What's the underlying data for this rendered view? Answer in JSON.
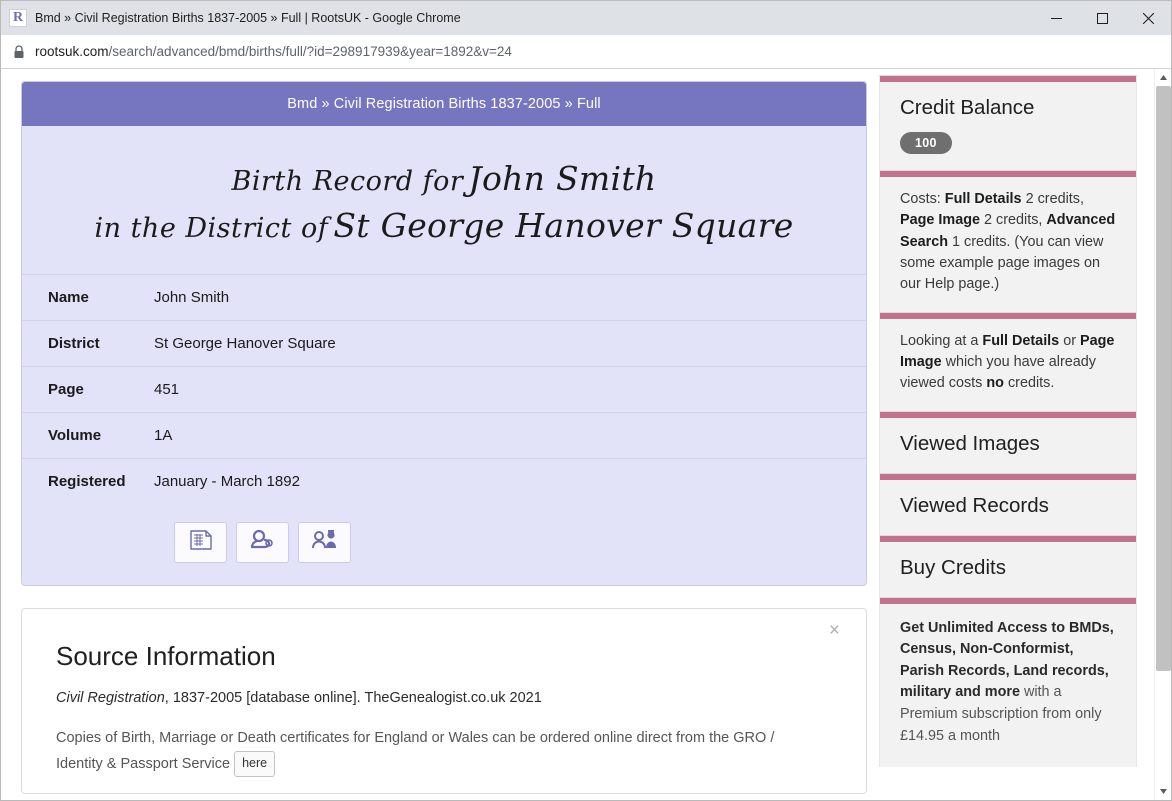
{
  "browser": {
    "window_title": "Bmd » Civil Registration Births 1837-2005 » Full | RootsUK - Google Chrome",
    "favicon_letter": "R",
    "url_domain": "rootsuk.com",
    "url_path": "/search/advanced/bmd/births/full/?id=298917939&year=1892&v=24",
    "minimize_label": "minimize-icon",
    "maximize_label": "maximize-icon",
    "close_label": "close-icon",
    "lock_label": "lock-icon"
  },
  "record": {
    "breadcrumb": "Bmd » Civil Registration Births 1837-2005 » Full",
    "title_line1": "Birth Record for",
    "title_name": "John Smith",
    "title_line2": "in the District of",
    "title_district": "St George Hanover Square",
    "fields": [
      {
        "key": "Name",
        "value": "John Smith"
      },
      {
        "key": "District",
        "value": "St George Hanover Square"
      },
      {
        "key": "Page",
        "value": "451"
      },
      {
        "key": "Volume",
        "value": "1A"
      },
      {
        "key": "Registered",
        "value": "January - March 1892"
      }
    ],
    "actions": [
      {
        "name": "page-image-icon",
        "title": "Page Image"
      },
      {
        "name": "baby-icon",
        "title": "Birth Record"
      },
      {
        "name": "family-icon",
        "title": "Family / People"
      }
    ]
  },
  "source": {
    "close_label": "×",
    "heading": "Source Information",
    "citation_italic": "Civil Registration",
    "citation_rest": ", 1837-2005 [database online]. TheGenealogist.co.uk 2021",
    "body_part1": "Copies of Birth, Marriage or Death certificates for England or Wales can be ordered online direct from the GRO / Identity & Passport Service",
    "here_label": "here"
  },
  "sidebar": {
    "credit_title": "Credit Balance",
    "credit_value": "100",
    "costs_prefix": "Costs:",
    "costs_item1_bold": "Full Details",
    "costs_item1_rest": "2 credits,",
    "costs_item2_bold": "Page Image",
    "costs_item2_rest": "2 credits,",
    "costs_item3_bold": "Advanced Search",
    "costs_item3_rest": "1 credits.",
    "costs_note": "(You can view some example page images on our Help page.)",
    "viewed_prefix": "Looking at a",
    "viewed_bold1": "Full Details",
    "viewed_mid1": "or",
    "viewed_bold2": "Page Image",
    "viewed_mid2": "which you have already viewed costs",
    "viewed_bold3": "no",
    "viewed_suffix": "credits.",
    "links": [
      {
        "label": "Viewed Images"
      },
      {
        "label": "Viewed Records"
      },
      {
        "label": "Buy Credits"
      }
    ],
    "promo_bold": "Get Unlimited Access to BMDs, Census, Non-Conformist, Parish Records, Land records, military and more",
    "promo_rest": "with a Premium subscription from only £14.95 a month"
  },
  "colors": {
    "header_purple": "#7575c0",
    "card_lavender": "#e2e2f8",
    "divider_rose": "#c3728d",
    "pill_grey": "#6f6f6f"
  }
}
